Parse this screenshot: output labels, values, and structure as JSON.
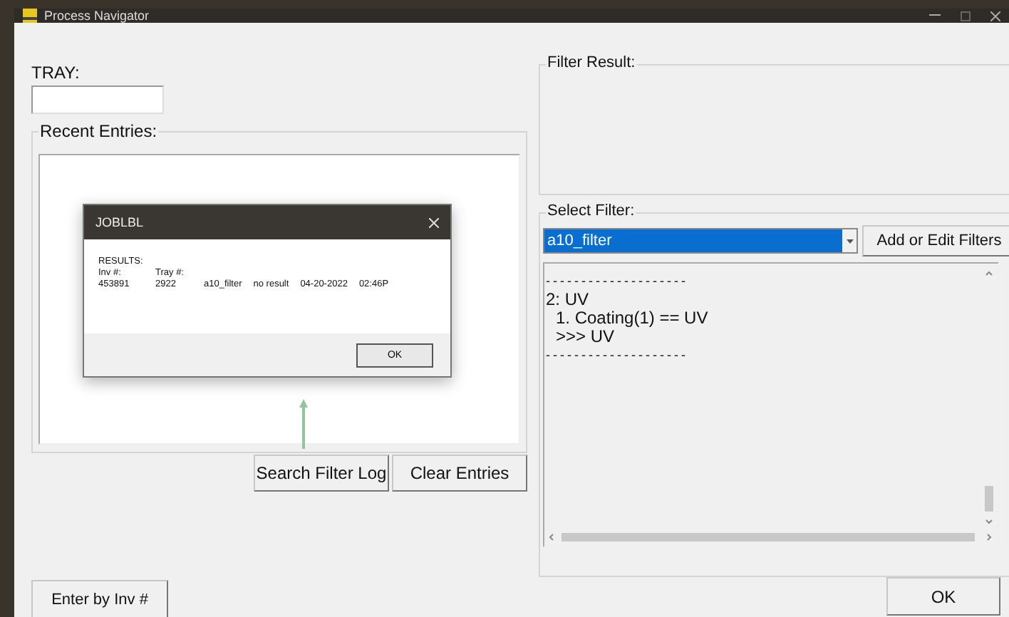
{
  "window": {
    "title": "Process Navigator"
  },
  "tray": {
    "label": "TRAY:"
  },
  "recent_entries": {
    "label": "Recent Entries:",
    "buttons": [
      "Search Filter Log",
      "Clear Entries"
    ]
  },
  "dialog": {
    "title": "JOBLBL",
    "heading": "RESULTS:",
    "columns": [
      "Inv #:",
      "Tray #:"
    ],
    "values": [
      "453891",
      "2922",
      "a10_filter",
      "no result",
      "04-20-2022",
      "02:46P"
    ],
    "button": "OK"
  },
  "filter_result": {
    "label": "Filter Result:"
  },
  "select_filter": {
    "label": "Select Filter:",
    "value": "a10_filter",
    "button": "Add or Edit Filters",
    "lines": [
      {
        "text": "--------------------",
        "indented": false
      },
      {
        "text": "2: UV",
        "indented": false
      },
      {
        "text": "1. Coating(1) == UV",
        "indented": true
      },
      {
        "text": ">>> UV",
        "indented": true
      },
      {
        "text": "--------------------",
        "indented": false
      }
    ]
  },
  "footer": {
    "left_button": "Enter by Inv #",
    "right_button": "OK"
  }
}
